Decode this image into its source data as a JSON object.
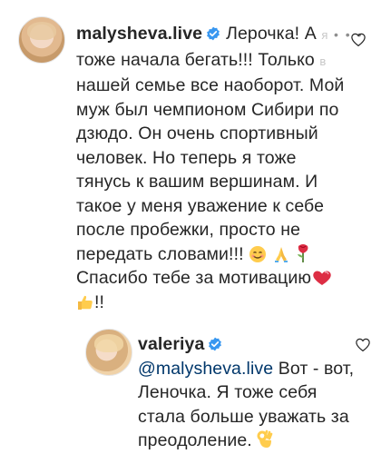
{
  "comments": [
    {
      "username": "malysheva.live",
      "verified": true,
      "line1": "Лерочка! А",
      "line1_faded": "я",
      "line2": "тоже начала бегать!!! Только",
      "line2_faded": "в",
      "line3": "нашей семье все наоборот. Мой",
      "line4": "муж был чемпионом Сибири по",
      "line5": "дзюдо. Он очень спортивный",
      "line6": "человек. Но теперь я тоже",
      "line7": "тянусь к вашим вершинам. И",
      "line8": "такое у меня уважение к себе",
      "line9": "после пробежки, просто не",
      "line10": "передать словами!!!",
      "line11": "Спасибо тебе за мотивацию",
      "line12_suffix": "!!",
      "more_label": "• • •",
      "emojis": [
        "smile-emoji",
        "pray-emoji",
        "rose-emoji",
        "heart-emoji",
        "thumbs-up-emoji"
      ]
    },
    {
      "username": "valeriya",
      "verified": true,
      "mention": "@malysheva.live",
      "line1_rest": "Вот - вот,",
      "line2": "Леночка. Я тоже себя",
      "line3": "стала больше уважать за",
      "line4": "преодоление.",
      "emojis": [
        "ok-hand-emoji"
      ]
    }
  ],
  "colors": {
    "verified": "#3897f0",
    "mention": "#00376b",
    "text": "#262626",
    "faded": "#c7c7c7"
  }
}
